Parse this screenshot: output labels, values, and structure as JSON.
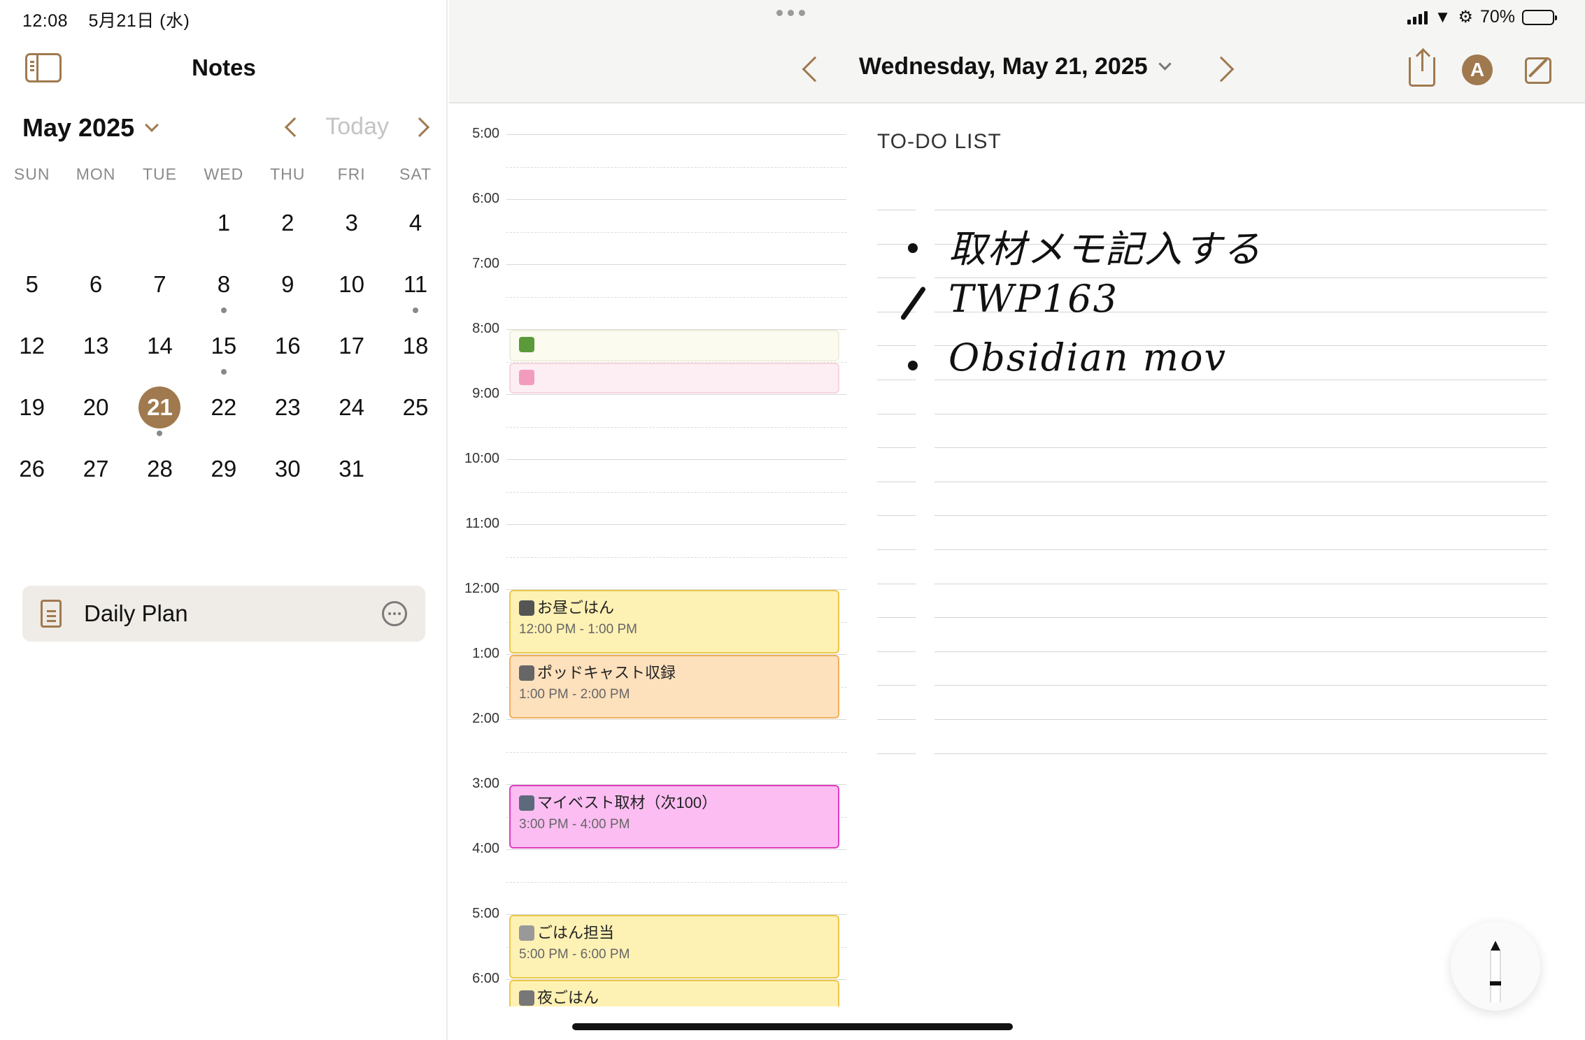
{
  "status": {
    "time": "12:08",
    "date": "5月21日 (水)",
    "battery": "70%",
    "battery_level": 0.7
  },
  "sidebar": {
    "title": "Notes",
    "month": "May 2025",
    "today_label": "Today",
    "weekdays": [
      "SUN",
      "MON",
      "TUE",
      "WED",
      "THU",
      "FRI",
      "SAT"
    ],
    "weeks": [
      [
        "",
        "",
        "",
        "1",
        "2",
        "3",
        "4"
      ],
      [
        "5",
        "6",
        "7",
        "8",
        "9",
        "10",
        "11"
      ],
      [
        "12",
        "13",
        "14",
        "15",
        "16",
        "17",
        "18"
      ],
      [
        "19",
        "20",
        "21",
        "22",
        "23",
        "24",
        "25"
      ],
      [
        "26",
        "27",
        "28",
        "29",
        "30",
        "31",
        ""
      ]
    ],
    "selected_day": "21",
    "days_with_dots": [
      "8",
      "11",
      "15",
      "21"
    ],
    "note": {
      "title": "Daily Plan"
    }
  },
  "main": {
    "date_title": "Wednesday, May 21, 2025",
    "pencil_label": "A",
    "todo_title": "TO-DO LIST",
    "hours": [
      "5:00",
      "6:00",
      "7:00",
      "8:00",
      "9:00",
      "10:00",
      "11:00",
      "12:00",
      "1:00",
      "2:00",
      "3:00",
      "4:00",
      "5:00",
      "6:00"
    ],
    "events": [
      {
        "title": "",
        "time": "",
        "start": 8.0,
        "end": 8.5,
        "bg": "#fbfbf0",
        "border": "#f0efdc",
        "icon_color": "#5a9a3a"
      },
      {
        "title": "",
        "time": "",
        "start": 8.5,
        "end": 9.0,
        "bg": "#fdeef3",
        "border": "#f5d5df",
        "icon_color": "#f29bbd"
      },
      {
        "title": "お昼ごはん",
        "time": "12:00 PM - 1:00 PM",
        "start": 12.0,
        "end": 13.0,
        "bg": "#fef1b4",
        "border": "#ecc84a",
        "icon_color": "#555"
      },
      {
        "title": "ポッドキャスト収録",
        "time": "1:00 PM - 2:00 PM",
        "start": 13.0,
        "end": 14.0,
        "bg": "#fde0bc",
        "border": "#f1b05a",
        "icon_color": "#666"
      },
      {
        "title": "マイベスト取材（次100）",
        "time": "3:00 PM - 4:00 PM",
        "start": 15.0,
        "end": 16.0,
        "bg": "#fbbdf2",
        "border": "#de3fbf",
        "icon_color": "#5c6a7c"
      },
      {
        "title": "ごはん担当",
        "time": "5:00 PM - 6:00 PM",
        "start": 17.0,
        "end": 18.0,
        "bg": "#fef1b4",
        "border": "#ecc84a",
        "icon_color": "#999"
      },
      {
        "title": "夜ごはん",
        "time": "",
        "start": 18.0,
        "end": 19.0,
        "bg": "#fef1b4",
        "border": "#ecc84a",
        "icon_color": "#777"
      }
    ],
    "todos": [
      {
        "text": "取材メモ記入する",
        "mark": "bullet"
      },
      {
        "text": "TWP163",
        "mark": "check"
      },
      {
        "text": "Obsidian mov",
        "mark": "bullet"
      }
    ]
  },
  "colors": {
    "accent": "#a0794f"
  }
}
